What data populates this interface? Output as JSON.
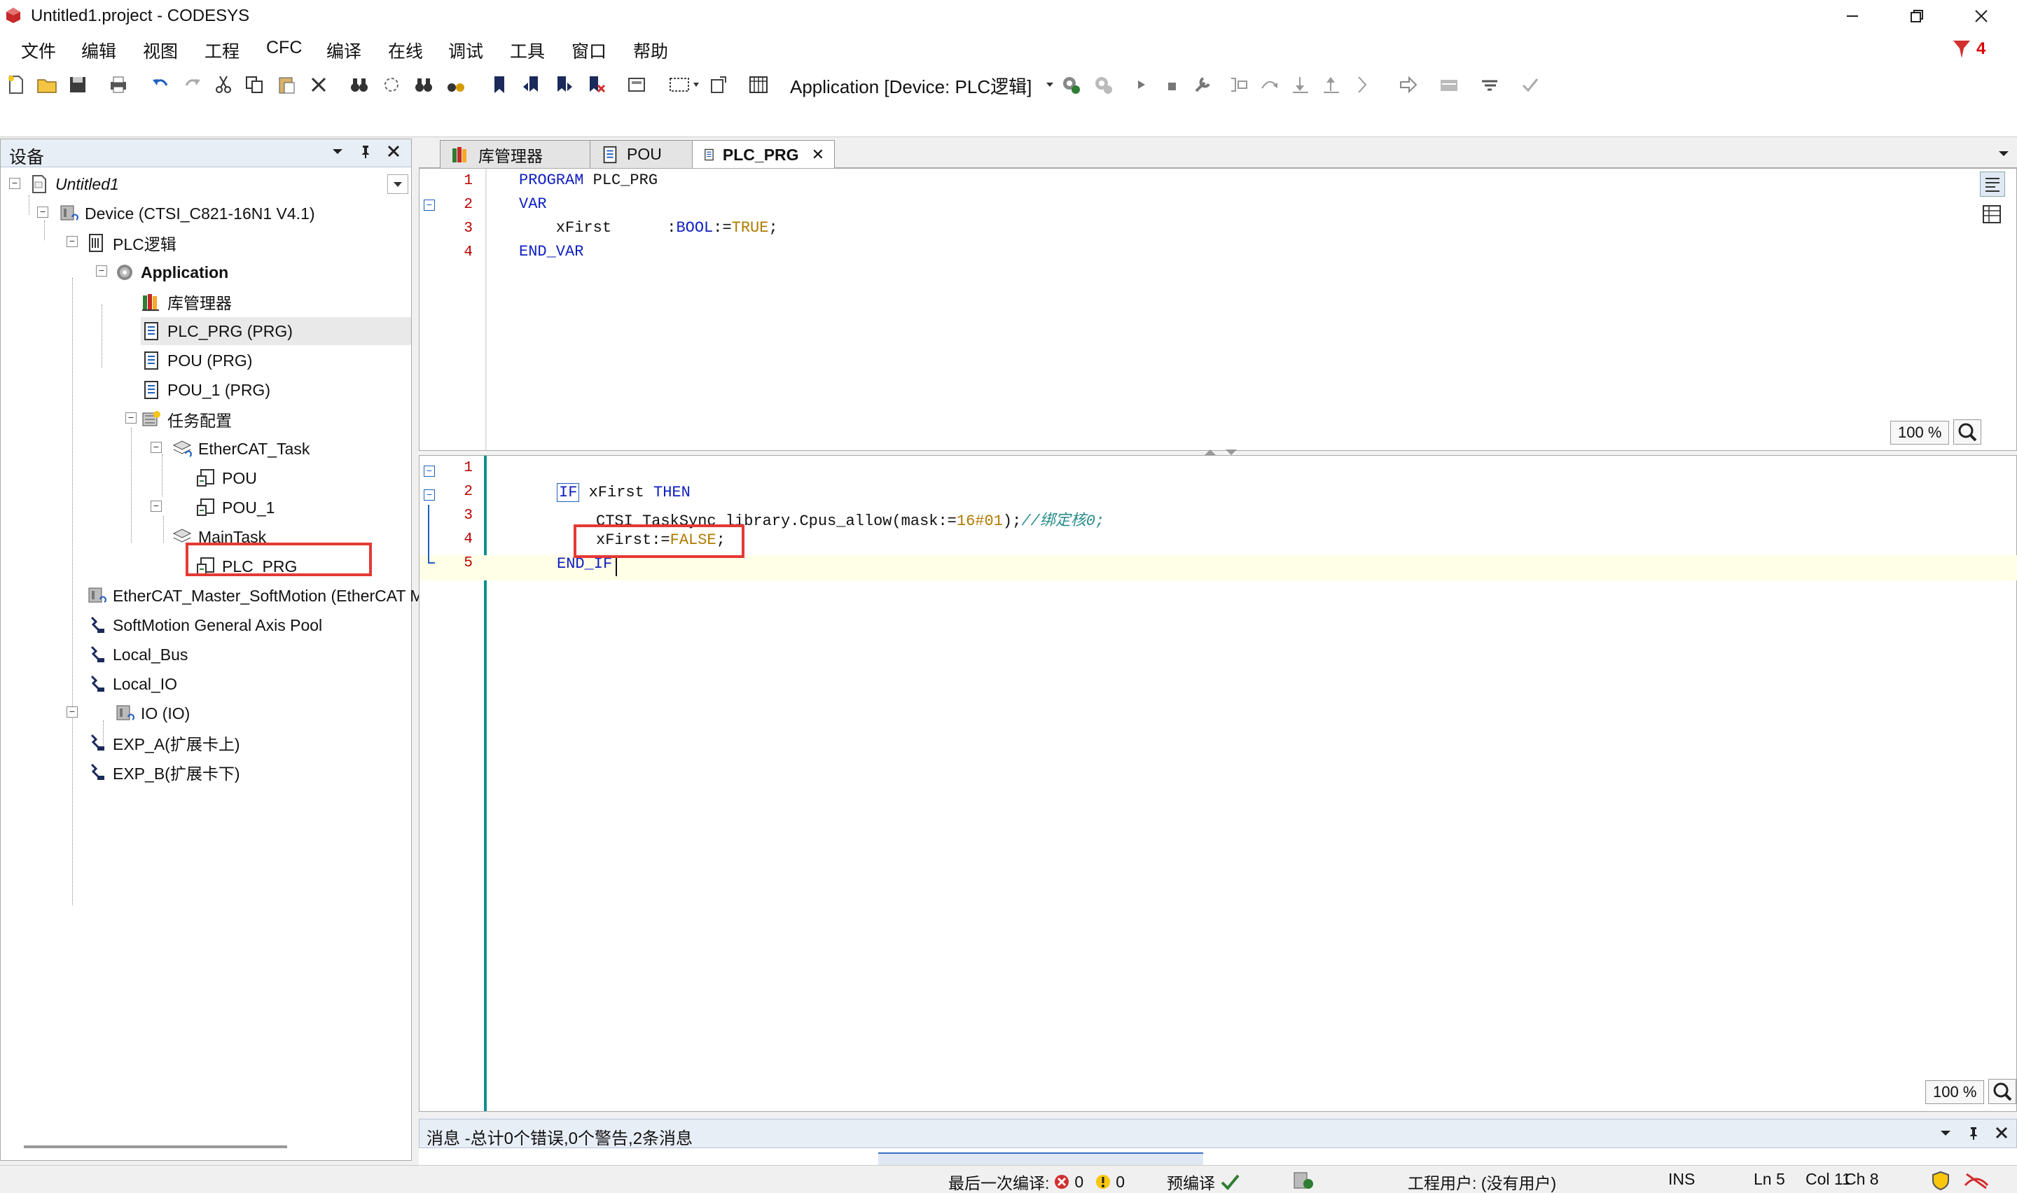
{
  "window": {
    "title": "Untitled1.project - CODESYS"
  },
  "menu": [
    "文件",
    "编辑",
    "视图",
    "工程",
    "CFC",
    "编译",
    "在线",
    "调试",
    "工具",
    "窗口",
    "帮助"
  ],
  "badge": {
    "count": "4"
  },
  "toolbar": {
    "app_selector": "Application [Device: PLC逻辑]"
  },
  "devices": {
    "title": "设备",
    "tree": {
      "root": "Untitled1",
      "device": "Device (CTSI_C821-16N1 V4.1)",
      "plc_logic": "PLC逻辑",
      "application": "Application",
      "library_manager": "库管理器",
      "plc_prg": "PLC_PRG (PRG)",
      "pou": "POU (PRG)",
      "pou_1": "POU_1 (PRG)",
      "task_config": "任务配置",
      "ethercat_task": "EtherCAT_Task",
      "ethercat_task_pou": "POU",
      "ethercat_task_pou_1": "POU_1",
      "main_task": "MainTask",
      "main_task_plc_prg": "PLC_PRG",
      "ethercat_master": "EtherCAT_Master_SoftMotion (EtherCAT M",
      "softmotion_pool": "SoftMotion General Axis Pool",
      "local_bus": "Local_Bus",
      "local_io": "Local_IO",
      "io": "IO (IO)",
      "exp_a": "EXP_A(扩展卡上)",
      "exp_b": "EXP_B(扩展卡下)"
    }
  },
  "tabs": [
    {
      "label": "库管理器"
    },
    {
      "label": "POU"
    },
    {
      "label": "PLC_PRG",
      "close": "✕"
    }
  ],
  "declaration": {
    "line_numbers": [
      "1",
      "2",
      "3",
      "4"
    ],
    "lines": {
      "l1_kw": "PROGRAM",
      "l1_name": " PLC_PRG",
      "l2_kw": "VAR",
      "l3_var": "    xFirst      :",
      "l3_type": "BOOL",
      "l3_assign": ":=",
      "l3_val": "TRUE",
      "l3_end": ";",
      "l4_kw": "END_VAR"
    },
    "zoom": "100 %"
  },
  "implementation": {
    "line_numbers": [
      "1",
      "2",
      "3",
      "4",
      "5"
    ],
    "lines": {
      "l2_if": "IF",
      "l2_var": " xFirst ",
      "l2_then": "THEN",
      "l3_call": "CTSI_TaskSync_library.Cpus_allow(mask:=",
      "l3_num": "16#01",
      "l3_end": ");",
      "l3_cmt": "//绑定核0;",
      "l4_var": "xFirst:=",
      "l4_val": "FALSE",
      "l4_end": ";",
      "l5_kw": "END_IF"
    },
    "zoom": "100 %"
  },
  "messages": {
    "title": "消息 -总计0个错误,0个警告,2条消息"
  },
  "status": {
    "last_compile_label": "最后一次编译:",
    "errors": "0",
    "warnings": "0",
    "precompile": "预编译",
    "project_user": "工程用户: (没有用户)",
    "ins": "INS",
    "ln": "Ln 5",
    "col": "Col 11",
    "ch": "Ch 8"
  },
  "colors": {
    "accent_red": "#e53935",
    "keyword_blue": "#1020c0",
    "gutter_teal": "#0f8f8f"
  }
}
